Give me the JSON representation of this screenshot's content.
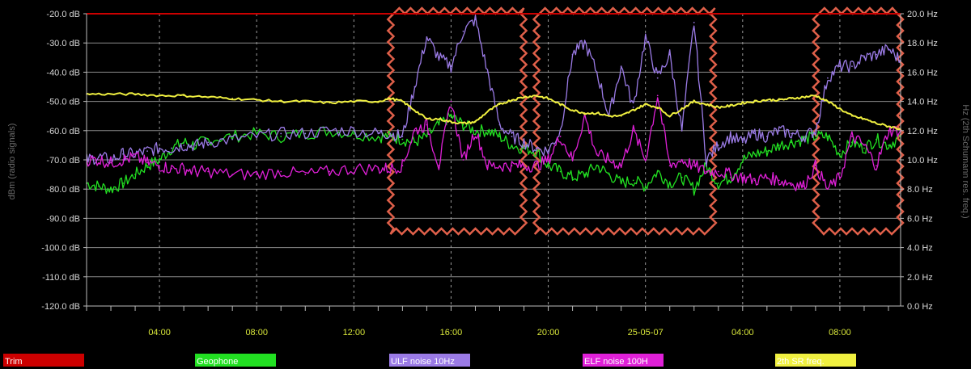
{
  "chart_data": {
    "type": "line",
    "ylabel_left": "dBm (radio signals)",
    "ylabel_right": "Hz (2th Schumann res. freq.)",
    "ylim_left": [
      -120,
      -20
    ],
    "ylim_right": [
      0,
      20
    ],
    "y_ticks_left": [
      "-20.0 dB",
      "-30.0 dB",
      "-40.0 dB",
      "-50.0 dB",
      "-60.0 dB",
      "-70.0 dB",
      "-80.0 dB",
      "-90.0 dB",
      "-100.0 dB",
      "-110.0 dB",
      "-120.0 dB"
    ],
    "y_ticks_right": [
      "20.0 Hz",
      "18.0 Hz",
      "16.0 Hz",
      "14.0 Hz",
      "12.0 Hz",
      "10.0 Hz",
      "8.0 Hz",
      "6.0 Hz",
      "4.0 Hz",
      "2.0 Hz",
      "0.0 Hz"
    ],
    "x_ticks": [
      "04:00",
      "08:00",
      "12:00",
      "16:00",
      "20:00",
      "25-05-07",
      "04:00",
      "08:00"
    ],
    "x_range_hours": [
      0,
      33.5
    ],
    "grid": true,
    "legend_position": "bottom",
    "highlights_hours": [
      [
        12.5,
        18.0
      ],
      [
        18.5,
        25.8
      ],
      [
        30.0,
        33.5
      ]
    ],
    "series": [
      {
        "name": "Trim",
        "color": "#cc0000",
        "axis": "left",
        "x": [
          0,
          33.5
        ],
        "y": [
          -20,
          -20
        ]
      },
      {
        "name": "Geophone",
        "color": "#22e022",
        "axis": "left",
        "x": [
          0,
          0.5,
          1,
          1.5,
          2,
          2.5,
          3,
          3.5,
          4,
          4.5,
          5,
          6,
          7,
          8,
          9,
          10,
          11,
          12,
          12.5,
          13,
          13.5,
          14,
          14.5,
          15,
          15.5,
          16,
          16.5,
          17,
          17.5,
          18,
          18.5,
          19,
          19.5,
          20,
          20.5,
          21,
          21.5,
          22,
          22.5,
          23,
          23.5,
          24,
          24.5,
          25,
          25.5,
          26,
          26.5,
          27,
          27.5,
          28,
          28.5,
          29,
          29.5,
          30,
          30.5,
          31,
          31.5,
          32,
          32.5,
          33,
          33.5
        ],
        "y": [
          -78,
          -79,
          -80,
          -78,
          -75,
          -72,
          -70,
          -66,
          -64,
          -65,
          -63,
          -62,
          -61,
          -62,
          -61,
          -60,
          -61,
          -62,
          -62,
          -63,
          -64,
          -62,
          -58,
          -55,
          -58,
          -60,
          -60,
          -62,
          -65,
          -66,
          -67,
          -72,
          -74,
          -76,
          -75,
          -72,
          -75,
          -78,
          -77,
          -79,
          -74,
          -78,
          -76,
          -80,
          -72,
          -78,
          -76,
          -70,
          -68,
          -67,
          -65,
          -64,
          -63,
          -62,
          -62,
          -68,
          -64,
          -66,
          -63,
          -65,
          -62
        ]
      },
      {
        "name": "ULF noise 10Hz",
        "color": "#9b7be6",
        "axis": "left",
        "x": [
          0,
          0.5,
          1,
          1.5,
          2,
          2.5,
          3,
          3.5,
          4,
          4.5,
          5,
          6,
          7,
          8,
          9,
          10,
          11,
          12,
          12.5,
          13,
          13.5,
          14,
          14.5,
          15,
          15.5,
          16,
          16.5,
          17,
          17.5,
          18,
          18.5,
          19,
          19.5,
          20,
          20.5,
          21,
          21.5,
          22,
          22.5,
          23,
          23.5,
          24,
          24.5,
          25,
          25.5,
          26,
          26.5,
          27,
          27.5,
          28,
          28.5,
          29,
          29.5,
          30,
          30.5,
          31,
          31.5,
          32,
          32.5,
          33,
          33.5
        ],
        "y": [
          -70,
          -69,
          -70,
          -68,
          -68,
          -67,
          -66,
          -66,
          -65,
          -65,
          -64,
          -63,
          -62,
          -61,
          -61,
          -60,
          -60,
          -61,
          -61,
          -62,
          -45,
          -28,
          -35,
          -38,
          -26,
          -22,
          -40,
          -58,
          -62,
          -64,
          -66,
          -67,
          -60,
          -34,
          -30,
          -40,
          -55,
          -38,
          -52,
          -28,
          -42,
          -34,
          -60,
          -23,
          -70,
          -65,
          -62,
          -64,
          -61,
          -62,
          -60,
          -61,
          -62,
          -60,
          -42,
          -38,
          -38,
          -35,
          -34,
          -32,
          -36
        ]
      },
      {
        "name": "ELF noise 100Hz",
        "color": "#e020d8",
        "axis": "left",
        "x": [
          0,
          0.5,
          1,
          1.5,
          2,
          2.5,
          3,
          3.5,
          4,
          4.5,
          5,
          6,
          7,
          8,
          9,
          10,
          11,
          12,
          12.5,
          13,
          13.5,
          14,
          14.5,
          15,
          15.5,
          16,
          16.5,
          17,
          17.5,
          18,
          18.5,
          19,
          19.5,
          20,
          20.5,
          21,
          21.5,
          22,
          22.5,
          23,
          23.5,
          24,
          24.5,
          25,
          25.5,
          26,
          26.5,
          27,
          27.5,
          28,
          28.5,
          29,
          29.5,
          30,
          30.5,
          31,
          31.5,
          32,
          32.5,
          33,
          33.5
        ],
        "y": [
          -70,
          -70,
          -71,
          -70,
          -69,
          -71,
          -72,
          -73,
          -73,
          -74,
          -74,
          -75,
          -75,
          -74,
          -75,
          -74,
          -73,
          -73,
          -73,
          -72,
          -60,
          -58,
          -72,
          -50,
          -70,
          -60,
          -72,
          -72,
          -72,
          -72,
          -72,
          -70,
          -62,
          -70,
          -55,
          -68,
          -70,
          -72,
          -60,
          -70,
          -48,
          -72,
          -70,
          -72,
          -74,
          -74,
          -75,
          -76,
          -77,
          -76,
          -77,
          -78,
          -79,
          -72,
          -80,
          -76,
          -62,
          -65,
          -72,
          -60,
          -60
        ]
      },
      {
        "name": "2th SR freq.",
        "color": "#f0f040",
        "axis": "right",
        "x": [
          0,
          1,
          2,
          3,
          4,
          5,
          6,
          7,
          8,
          9,
          10,
          11,
          12,
          12.5,
          13,
          13.5,
          14,
          14.5,
          15,
          15.5,
          16,
          16.5,
          17,
          17.5,
          18,
          18.5,
          19,
          19.5,
          20,
          20.5,
          21,
          21.5,
          22,
          22.5,
          23,
          23.5,
          24,
          24.5,
          25,
          25.5,
          26,
          26.5,
          27,
          27.5,
          28,
          28.5,
          29,
          29.5,
          30,
          30.5,
          31,
          31.5,
          32,
          32.5,
          33,
          33.5
        ],
        "y": [
          14.5,
          14.5,
          14.5,
          14.4,
          14.4,
          14.3,
          14.2,
          14.1,
          14.0,
          14.0,
          13.9,
          14.0,
          14.0,
          14.2,
          14.0,
          13.4,
          12.8,
          12.8,
          12.6,
          12.5,
          12.6,
          13.3,
          13.8,
          14.1,
          14.3,
          14.4,
          14.2,
          13.8,
          13.4,
          13.2,
          13.2,
          13.0,
          13.0,
          13.4,
          13.8,
          13.6,
          13.0,
          13.5,
          14.0,
          13.8,
          13.6,
          13.7,
          13.9,
          14.0,
          14.1,
          14.1,
          14.2,
          14.3,
          14.4,
          14.0,
          13.5,
          13.0,
          12.8,
          12.5,
          12.3,
          12.1
        ]
      }
    ]
  },
  "legend": {
    "items": [
      {
        "label": "Trim",
        "color": "#cc0000"
      },
      {
        "label": "Geophone",
        "color": "#22e022"
      },
      {
        "label": "ULF noise 10Hz",
        "color": "#9b7be6"
      },
      {
        "label": "ELF noise 100H",
        "color": "#e020d8"
      },
      {
        "label": "2th SR freq.",
        "color": "#f0f040"
      }
    ]
  }
}
